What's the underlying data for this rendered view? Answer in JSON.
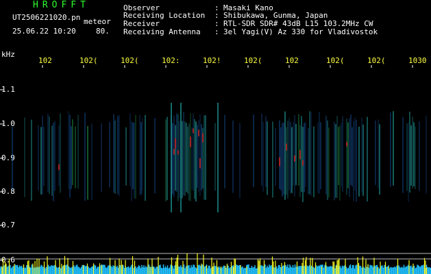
{
  "header": {
    "app_title": "HROFFT",
    "file_name": "UT2506221020.pn",
    "meteor_label": "meteor",
    "date_time": "25.06.22 10:20",
    "count": "80.",
    "info": [
      {
        "label": "Observer",
        "value": "Masaki Kano"
      },
      {
        "label": "Receiving Location",
        "value": "Shibukawa, Gunma, Japan"
      },
      {
        "label": "Receiver",
        "value": "RTL-SDR SDR# 43dB L15 103.2MHz CW"
      },
      {
        "label": "Receiving Antenna",
        "value": "3el Yagi(V) Az 330 for Vladivostok"
      }
    ],
    "colon": ":"
  },
  "axis": {
    "y_unit": "kHz",
    "y_ticks": [
      "1.1",
      "1.0",
      "0.9",
      "0.8",
      "0.7",
      "0.6"
    ],
    "x_ticks": [
      "102",
      "102(",
      "102(",
      "102:",
      "102!",
      "102(",
      "102",
      "102(",
      "102(",
      "1030"
    ]
  },
  "colors": {
    "background": "#000000",
    "label_white": "#ffffff",
    "title_green": "#2fff2f",
    "time_yellow": "#ffff40",
    "spectrum_blue": "#1e6fd0",
    "spectrum_cyan": "#30e0e0",
    "hot_red": "#ff3030",
    "signal_bar_yellow": "#ffff20",
    "signal_bar_cyan": "#20c0ff"
  }
}
